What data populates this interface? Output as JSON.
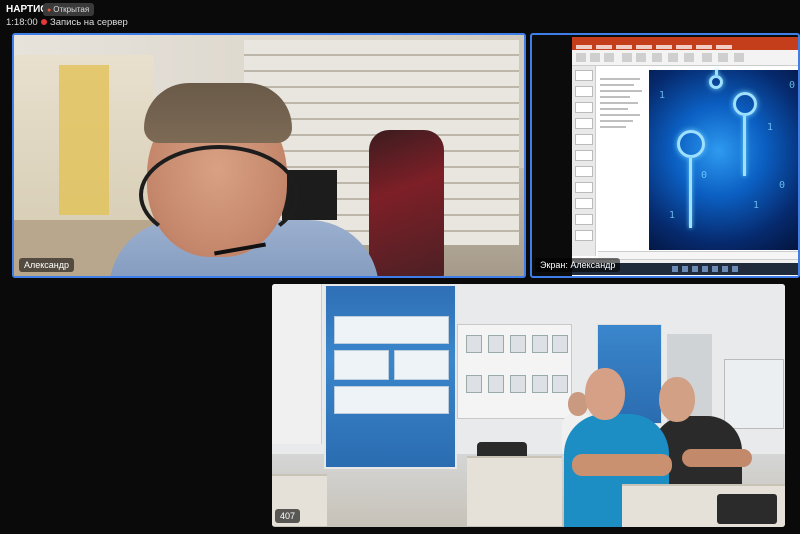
{
  "header": {
    "app_title": "НАРТИС",
    "access_badge": "Открытая",
    "timer": "1:18:00",
    "record_status": "Запись на сервер"
  },
  "tiles": {
    "speaker": {
      "name": "Александр"
    },
    "screen": {
      "name": "Экран: Александр"
    },
    "room": {
      "name": "407"
    }
  },
  "colors": {
    "active_border": "#3f7ee8",
    "record_dot": "#e5383b",
    "background": "#0a0a0a"
  }
}
